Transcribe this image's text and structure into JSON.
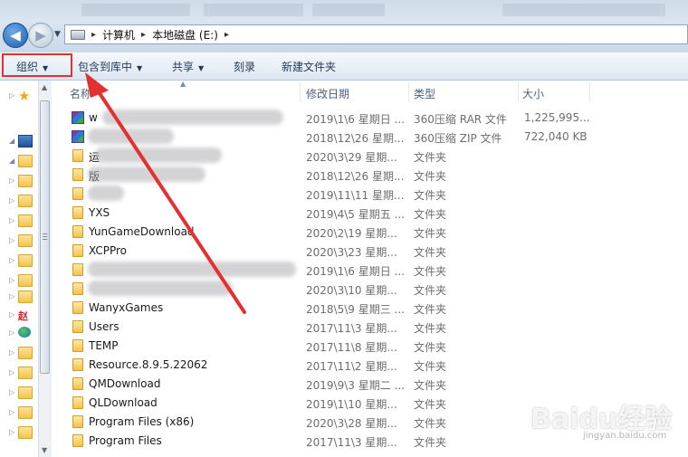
{
  "address_bar": {
    "crumbs": [
      "计算机",
      "本地磁盘 (E:)"
    ],
    "separator": "▸"
  },
  "toolbar": {
    "organize": "组织",
    "include_library": "包含到库中",
    "share": "共享",
    "burn": "刻录",
    "new_folder": "新建文件夹"
  },
  "columns": {
    "name": "名称",
    "date": "修改日期",
    "type": "类型",
    "size": "大小"
  },
  "files": [
    {
      "name": "w",
      "date": "2019\\1\\6 星期日 ...",
      "type": "360压缩 RAR 文件",
      "size": "1,225,995...",
      "icon": "archive-icon",
      "redacted": true
    },
    {
      "name": "",
      "date": "2018\\12\\26 星期...",
      "type": "360压缩 ZIP 文件",
      "size": "722,040 KB",
      "icon": "archive-icon",
      "redacted": true
    },
    {
      "name": "运",
      "date": "2020\\3\\29 星期...",
      "type": "文件夹",
      "size": "",
      "icon": "folder-icon",
      "redacted": true
    },
    {
      "name": "版",
      "date": "2018\\12\\26 星期...",
      "type": "文件夹",
      "size": "",
      "icon": "folder-icon",
      "redacted": true
    },
    {
      "name": "",
      "date": "2019\\11\\11 星期...",
      "type": "文件夹",
      "size": "",
      "icon": "folder-icon",
      "redacted": true
    },
    {
      "name": "YXS",
      "date": "2019\\4\\5 星期五 ...",
      "type": "文件夹",
      "size": "",
      "icon": "folder-icon",
      "redacted": false
    },
    {
      "name": "YunGameDownload",
      "date": "2020\\2\\19 星期...",
      "type": "文件夹",
      "size": "",
      "icon": "folder-icon",
      "redacted": false
    },
    {
      "name": "XCPPro",
      "date": "2020\\3\\23 星期...",
      "type": "文件夹",
      "size": "",
      "icon": "folder-icon",
      "redacted": false
    },
    {
      "name": "",
      "date": "2019\\1\\6 星期日 ...",
      "type": "文件夹",
      "size": "",
      "icon": "folder-icon",
      "redacted": true
    },
    {
      "name": "",
      "date": "2020\\3\\10 星期...",
      "type": "文件夹",
      "size": "",
      "icon": "folder-icon",
      "redacted": true
    },
    {
      "name": "WanyxGames",
      "date": "2018\\5\\9 星期三 ...",
      "type": "文件夹",
      "size": "",
      "icon": "folder-icon",
      "redacted": false
    },
    {
      "name": "Users",
      "date": "2017\\11\\3 星期...",
      "type": "文件夹",
      "size": "",
      "icon": "folder-icon",
      "redacted": false
    },
    {
      "name": "TEMP",
      "date": "2017\\11\\8 星期...",
      "type": "文件夹",
      "size": "",
      "icon": "folder-icon",
      "redacted": false
    },
    {
      "name": "Resource.8.9.5.22062",
      "date": "2017\\11\\2 星期...",
      "type": "文件夹",
      "size": "",
      "icon": "folder-icon",
      "redacted": false
    },
    {
      "name": "QMDownload",
      "date": "2019\\9\\3 星期二 ...",
      "type": "文件夹",
      "size": "",
      "icon": "folder-icon",
      "redacted": false
    },
    {
      "name": "QLDownload",
      "date": "2019\\1\\10 星期...",
      "type": "文件夹",
      "size": "",
      "icon": "folder-icon",
      "redacted": false
    },
    {
      "name": "Program Files (x86)",
      "date": "2020\\3\\28 星期...",
      "type": "文件夹",
      "size": "",
      "icon": "folder-icon",
      "redacted": false
    },
    {
      "name": "Program Files",
      "date": "2017\\11\\3 星期...",
      "type": "文件夹",
      "size": "",
      "icon": "folder-icon",
      "redacted": false
    }
  ],
  "nav_pane": [
    {
      "icon": "star-icon"
    },
    {
      "icon": "computer-icon"
    },
    {
      "icon": "folder-icon"
    },
    {
      "icon": "folder-icon"
    },
    {
      "icon": "folder-icon"
    },
    {
      "icon": "folder-icon"
    },
    {
      "icon": "folder-icon"
    },
    {
      "icon": "folder-icon"
    },
    {
      "icon": "folder-icon"
    },
    {
      "icon": "folder-icon"
    },
    {
      "icon": "app-icon",
      "label": "赵"
    },
    {
      "icon": "globe-icon"
    },
    {
      "icon": "folder-icon"
    },
    {
      "icon": "folder-icon"
    },
    {
      "icon": "folder-icon"
    },
    {
      "icon": "folder-icon"
    },
    {
      "icon": "folder-icon"
    }
  ],
  "watermark": {
    "brand": "Baidu经验",
    "url": "jingyan.baidu.com"
  },
  "colors": {
    "highlight_box": "#e53030",
    "arrow": "#e53030"
  }
}
